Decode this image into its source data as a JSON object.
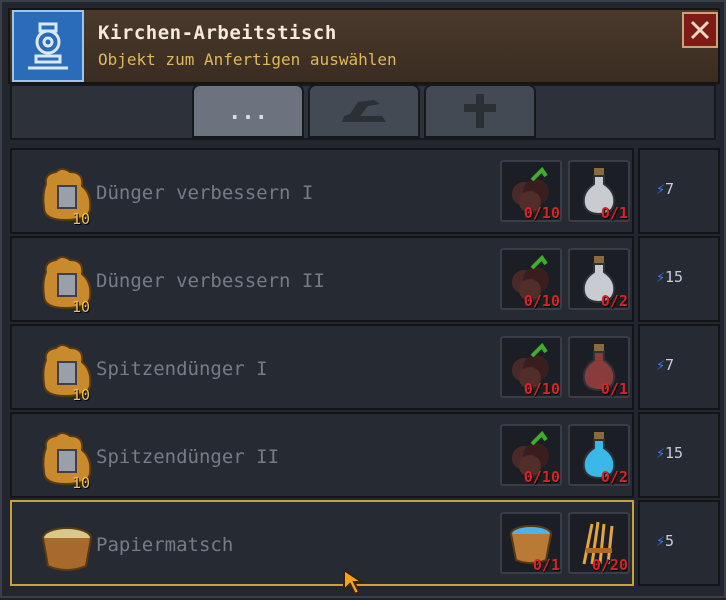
{
  "header": {
    "title": "Kirchen-Arbeitstisch",
    "subtitle": "Objekt zum Anfertigen auswählen"
  },
  "tabs": [
    {
      "label": "...",
      "icon": "dots-icon",
      "active": true
    },
    {
      "label": "",
      "icon": "anvil-icon",
      "active": false
    },
    {
      "label": "",
      "icon": "cross-icon",
      "active": false
    }
  ],
  "recipes": [
    {
      "name": "Dünger verbessern I",
      "count": "10",
      "icon": "fertilizer-sack-icon",
      "ingredients": [
        {
          "icon": "dirt-pile-icon",
          "amount": "0/10"
        },
        {
          "icon": "grey-potion-icon",
          "amount": "0/1"
        }
      ],
      "energy": "7",
      "selected": false
    },
    {
      "name": "Dünger verbessern II",
      "count": "10",
      "icon": "fertilizer-sack-icon",
      "ingredients": [
        {
          "icon": "dirt-pile-icon",
          "amount": "0/10"
        },
        {
          "icon": "grey-potion-icon",
          "amount": "0/2"
        }
      ],
      "energy": "15",
      "selected": false
    },
    {
      "name": "Spitzendünger I",
      "count": "10",
      "icon": "fertilizer-sack-icon",
      "ingredients": [
        {
          "icon": "dirt-pile-icon",
          "amount": "0/10"
        },
        {
          "icon": "red-potion-icon",
          "amount": "0/1"
        }
      ],
      "energy": "7",
      "selected": false
    },
    {
      "name": "Spitzendünger II",
      "count": "10",
      "icon": "fertilizer-sack-icon",
      "ingredients": [
        {
          "icon": "dirt-pile-icon",
          "amount": "0/10"
        },
        {
          "icon": "blue-potion-icon",
          "amount": "0/2"
        }
      ],
      "energy": "15",
      "selected": false
    },
    {
      "name": "Papiermatsch",
      "count": "",
      "icon": "bucket-pulp-icon",
      "ingredients": [
        {
          "icon": "water-bucket-icon",
          "amount": "0/1"
        },
        {
          "icon": "wheat-bundle-icon",
          "amount": "0/20"
        }
      ],
      "energy": "5",
      "selected": true
    }
  ],
  "colors": {
    "header_bg": "#3a2c21",
    "title": "#f4ead8",
    "subtitle": "#e0b85a",
    "disabled_text": "#767c86",
    "missing_amount": "#d8232a",
    "energy_bolt": "#3b7bff",
    "selection_border": "#c9a13a",
    "close_button": "#7e1b16"
  }
}
